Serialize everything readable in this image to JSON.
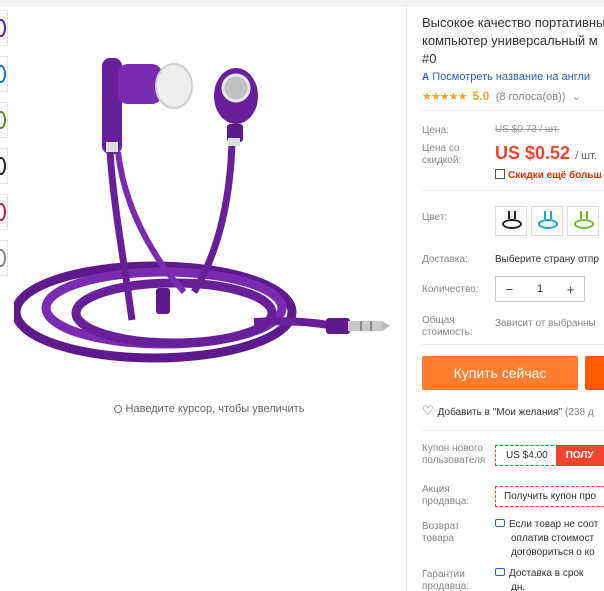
{
  "zoom_hint": "Наведите курсор, чтобы увеличить",
  "product": {
    "title_lines": [
      "Высокое качество портативны",
      "компьютер универсальный м",
      "#0"
    ],
    "translate_label": "Посмотреть название на англи",
    "translate_icon": "ai-translate-icon",
    "rating": {
      "stars": "★★★★★",
      "value": "5.0",
      "votes": "(8 голоса(ов))",
      "caret": "⌄"
    }
  },
  "price": {
    "label": "Цена:",
    "old_value": "US $0.73 / шт.",
    "discount_label": "Цена со скидкой:",
    "new_value": "US $0.52",
    "unit": "/ шт.",
    "more_discount": "Скидки ещё больш"
  },
  "color": {
    "label": "Цвет:",
    "options": [
      "black",
      "blue",
      "green"
    ]
  },
  "shipping": {
    "label": "Доставка:",
    "value": "Выберите страну отпр"
  },
  "quantity": {
    "label": "Количество:",
    "value": "1",
    "minus": "−",
    "plus": "+"
  },
  "total": {
    "label": "Общая стоимость:",
    "value": "Зависит от выбранны"
  },
  "buttons": {
    "buy_now": "Купить сейчас"
  },
  "wishlist": {
    "label": "Добавить в \"Мои желания\"",
    "count": "(238 д"
  },
  "coupon_new": {
    "label": "Купон нового пользователя",
    "amount": "US $4.00",
    "button": "ПОЛУ"
  },
  "seller_promo": {
    "label": "Акция продавца:",
    "button": "Получить купон про"
  },
  "returns": {
    "label": "Возврат товара",
    "lines": [
      "Если товар не соот",
      "оплатив стоимост",
      "договориться о ко"
    ]
  },
  "guarantee": {
    "label": "Гарантии продавца:",
    "line": "Доставка в срок",
    "line2": "дн."
  },
  "colors": {
    "price_red": "#f0442e",
    "buy_orange": "#ff7d2e",
    "star_gold": "#f2a51c",
    "link_blue": "#2a63c1",
    "product_purple": "#6a1f9a"
  }
}
